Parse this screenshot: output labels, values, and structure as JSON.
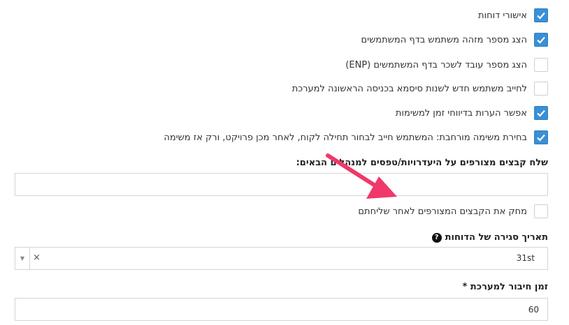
{
  "settings": [
    {
      "label": "אישורי דוחות",
      "checked": true
    },
    {
      "label": "הצג מספר מזהה משתמש בדף המשתמשים",
      "checked": true
    },
    {
      "label": "הצג מספר עובד לשכר בדף המשתמשים (ENP)",
      "checked": false
    },
    {
      "label": "לחייב משתמש חדש לשנות סיסמא בכניסה הראשונה למערכת",
      "checked": false
    },
    {
      "label": "אפשר הערות בדיווחי זמן למשימות",
      "checked": true
    },
    {
      "label": "בחירת משימה מורחבת: המשתמש חייב לבחור תחילה לקוח, לאחר מכן פרויקט, ורק אז משימה",
      "checked": true
    }
  ],
  "attachments_email": {
    "label": "שלח קבצים מצורפים על היעדרויות/טפסים למנהלים הבאים:",
    "value": ""
  },
  "delete_after_send": {
    "label": "מחק את הקבצים המצורפים לאחר שליחתם",
    "checked": false
  },
  "closing_date": {
    "label": "תאריך סגירה של הדוחות",
    "help_icon": "question-circle-icon",
    "value": "31st",
    "clear_glyph": "×",
    "arrow_glyph": "▼"
  },
  "session_time": {
    "label": "זמן חיבור למערכת *",
    "value": "60"
  },
  "colors": {
    "accent": "#3a8fd6",
    "annotation_arrow": "#f0386b"
  }
}
